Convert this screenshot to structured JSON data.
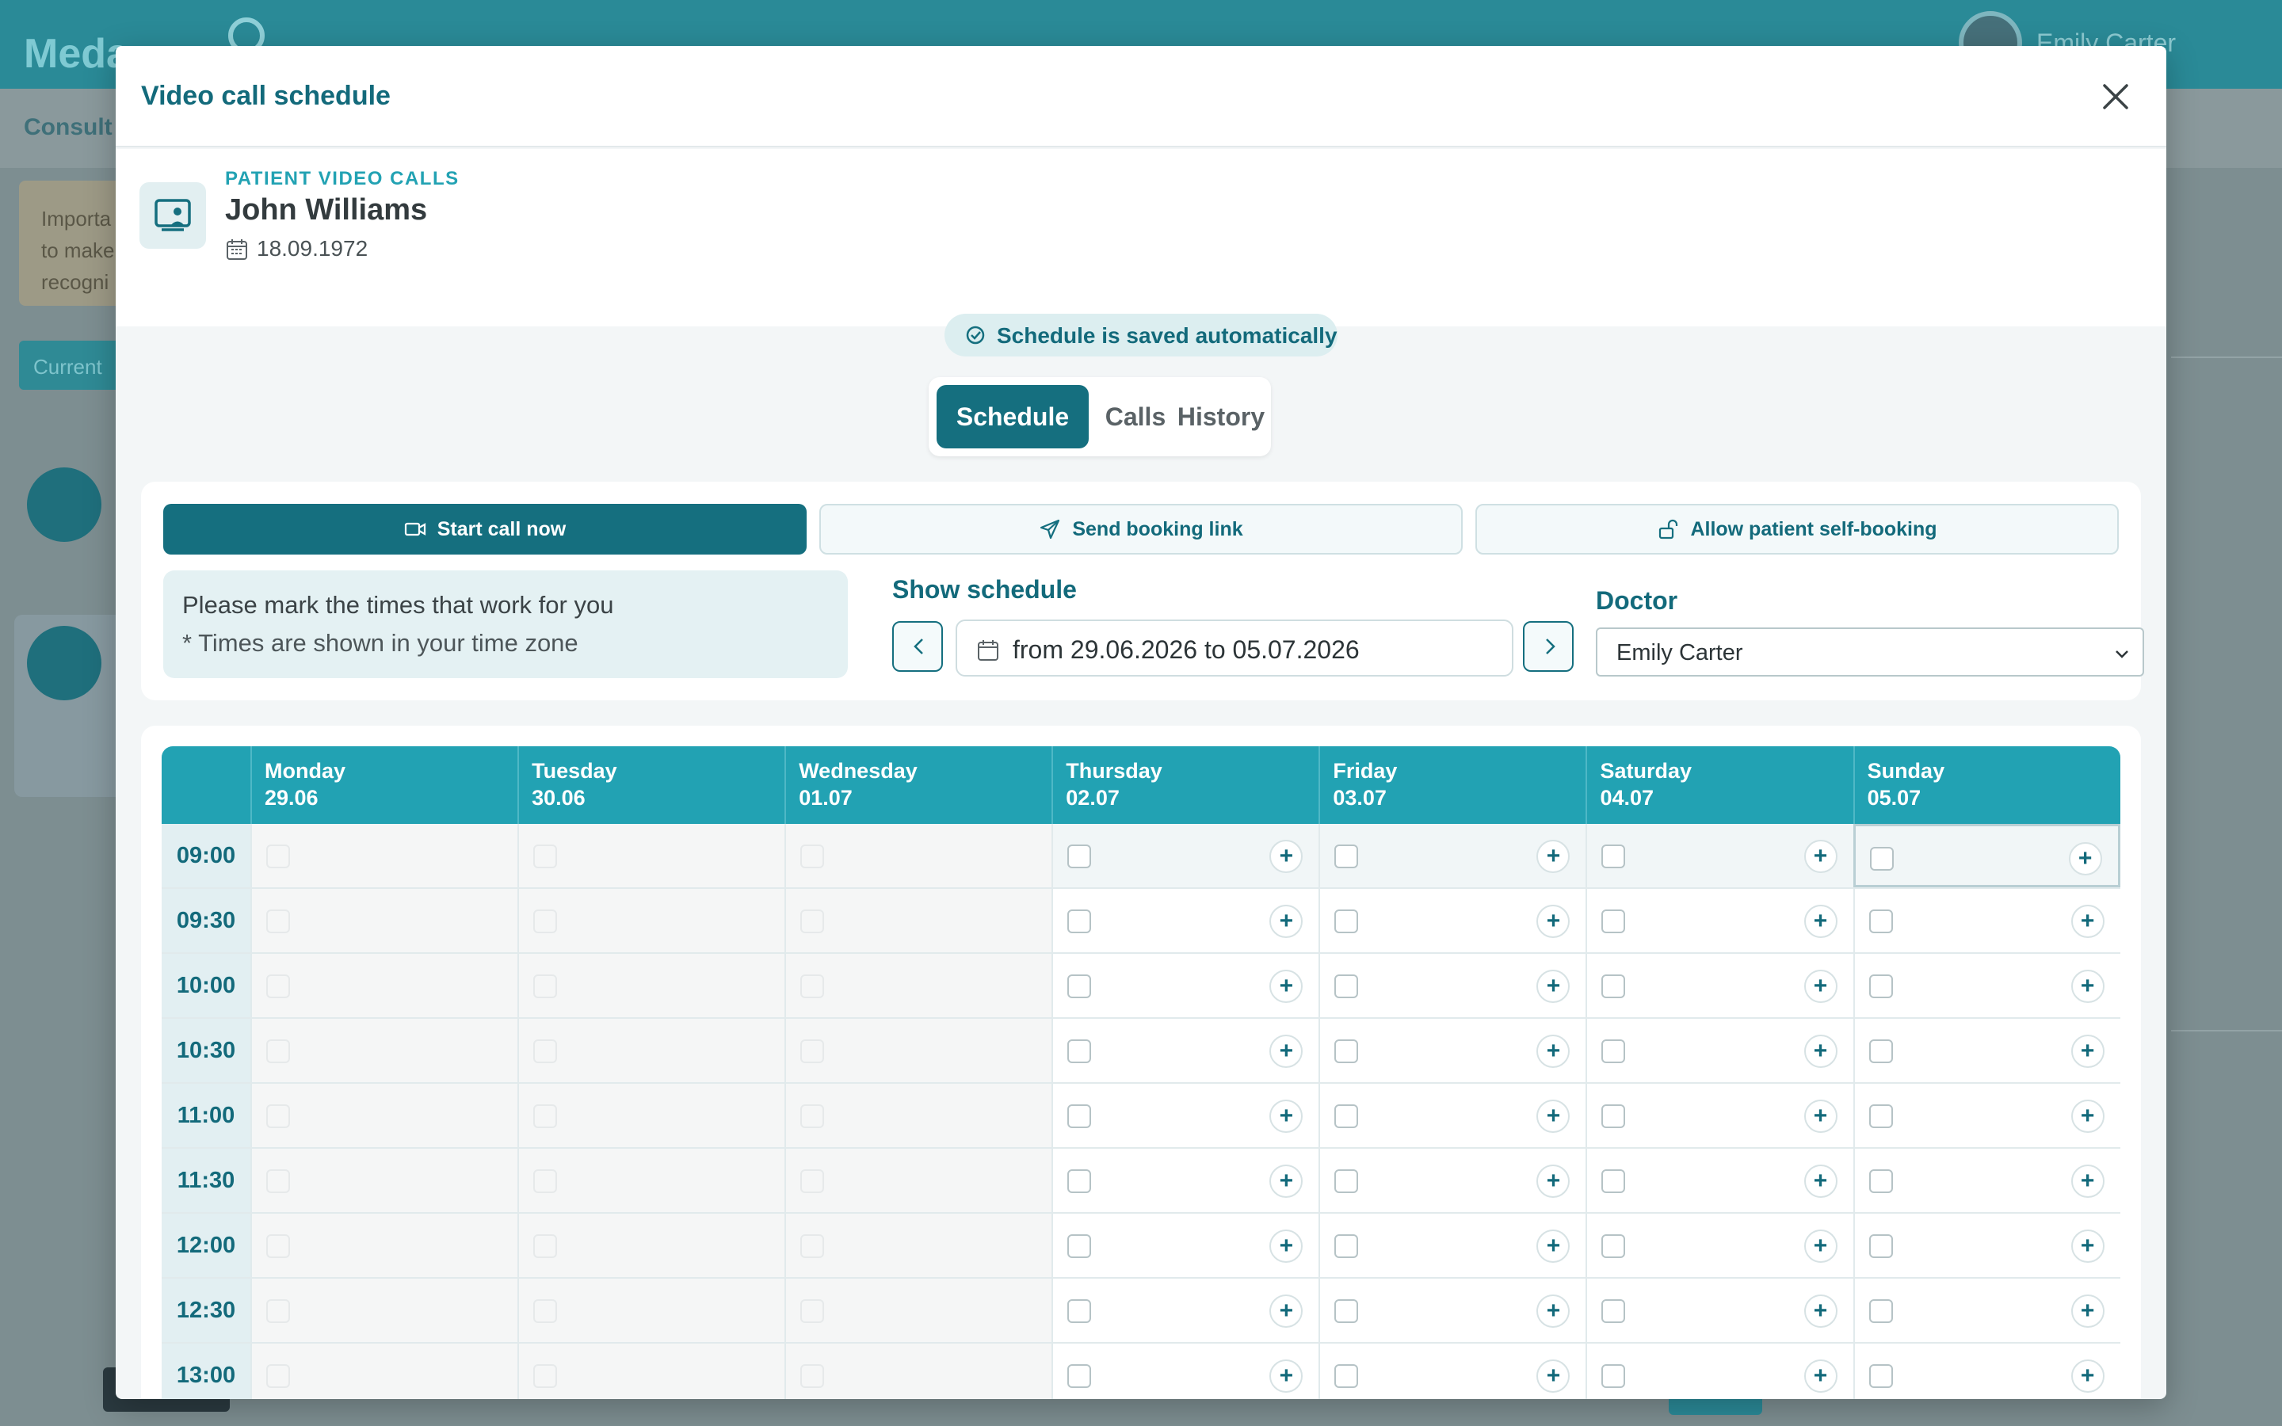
{
  "background": {
    "brand": "Meda",
    "user_name": "Emily Carter",
    "subnav_label": "Consult",
    "panel_text_1": "Importa",
    "panel_text_2": "to make",
    "panel_text_3": "recogni",
    "current_label": "Current"
  },
  "modal": {
    "title": "Video call schedule",
    "close_icon": "close-icon"
  },
  "patient": {
    "label": "PATIENT VIDEO CALLS",
    "name": "John Williams",
    "dob": "18.09.1972"
  },
  "status": {
    "saved_text": "Schedule is saved automatically"
  },
  "tabs": [
    {
      "label": "Schedule",
      "active": true
    },
    {
      "label": "Calls",
      "active": false
    },
    {
      "label": "History",
      "active": false
    }
  ],
  "actions": {
    "start_call": "Start call now",
    "send_link": "Send booking link",
    "self_booking": "Allow patient self-booking"
  },
  "info": {
    "line1": "Please mark the times that work for you",
    "line2": "* Times are shown in your time zone"
  },
  "schedule_range": {
    "label": "Show schedule",
    "value": "from 29.06.2026 to 05.07.2026"
  },
  "doctor": {
    "label": "Doctor",
    "selected": "Emily Carter"
  },
  "grid": {
    "days": [
      {
        "name": "Monday",
        "date": "29.06",
        "past": true
      },
      {
        "name": "Tuesday",
        "date": "30.06",
        "past": true
      },
      {
        "name": "Wednesday",
        "date": "01.07",
        "past": true
      },
      {
        "name": "Thursday",
        "date": "02.07",
        "past": false
      },
      {
        "name": "Friday",
        "date": "03.07",
        "past": false
      },
      {
        "name": "Saturday",
        "date": "04.07",
        "past": false
      },
      {
        "name": "Sunday",
        "date": "05.07",
        "past": false
      }
    ],
    "times": [
      "09:00",
      "09:30",
      "10:00",
      "10:30",
      "11:00",
      "11:30",
      "12:00",
      "12:30",
      "13:00"
    ],
    "add_symbol": "+"
  },
  "colors": {
    "primary": "#156f7f",
    "accent": "#22a2b3",
    "title": "#136a7b"
  }
}
